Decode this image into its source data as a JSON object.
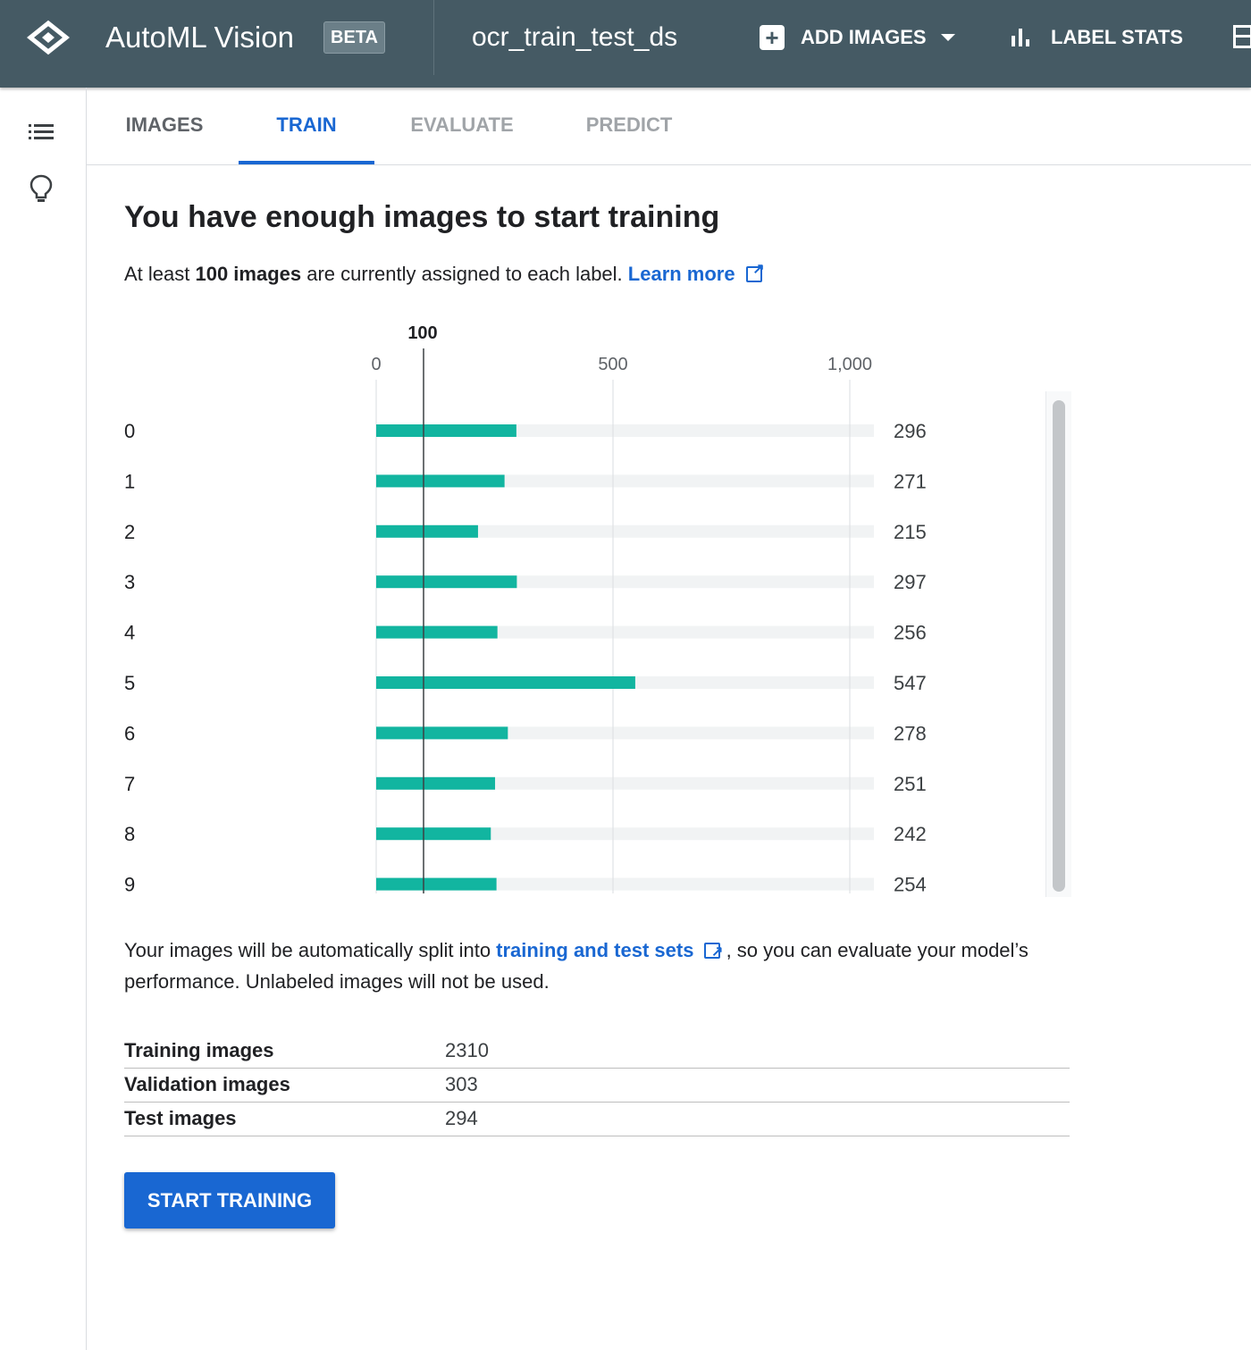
{
  "appbar": {
    "title": "AutoML Vision",
    "badge": "BETA",
    "dataset": "ocr_train_test_ds",
    "add_images": "ADD IMAGES",
    "label_stats": "LABEL STATS",
    "icons": [
      "automl-logo-icon",
      "plus-icon",
      "caret-down-icon",
      "bar-chart-icon",
      "more-icon"
    ]
  },
  "rail": {
    "icons": [
      "list-icon",
      "lightbulb-icon"
    ]
  },
  "tabs": [
    {
      "label": "IMAGES",
      "active": false
    },
    {
      "label": "TRAIN",
      "active": true
    },
    {
      "label": "EVALUATE",
      "active": false
    },
    {
      "label": "PREDICT",
      "active": false
    }
  ],
  "main": {
    "heading": "You have enough images to start training",
    "subtitle_pre": "At least ",
    "subtitle_bold": "100 images",
    "subtitle_post": " are currently assigned to each label. ",
    "learn_more": "Learn more",
    "split_pre": "Your images will be automatically split into ",
    "split_link": "training and test sets",
    "split_post": " , so you can evaluate your model’s performance. Unlabeled images will not be used.",
    "start_button": "START TRAINING"
  },
  "chart_data": {
    "type": "bar",
    "orientation": "horizontal",
    "categories": [
      "0",
      "1",
      "2",
      "3",
      "4",
      "5",
      "6",
      "7",
      "8",
      "9"
    ],
    "values": [
      296,
      271,
      215,
      297,
      256,
      547,
      278,
      251,
      242,
      254
    ],
    "ticks": [
      {
        "value": 0,
        "label": "0"
      },
      {
        "value": 500,
        "label": "500"
      },
      {
        "value": 1000,
        "label": "1,000"
      }
    ],
    "threshold": {
      "value": 100,
      "label": "100"
    },
    "xlim": [
      0,
      1050
    ],
    "bar_color": "#12b5a0",
    "track_color": "#f1f3f4",
    "grid": true
  },
  "stats": [
    {
      "label": "Training images",
      "value": "2310"
    },
    {
      "label": "Validation images",
      "value": "303"
    },
    {
      "label": "Test images",
      "value": "294"
    }
  ],
  "colors": {
    "appbar": "#455a64",
    "accent": "#1967d2",
    "bar": "#12b5a0"
  }
}
